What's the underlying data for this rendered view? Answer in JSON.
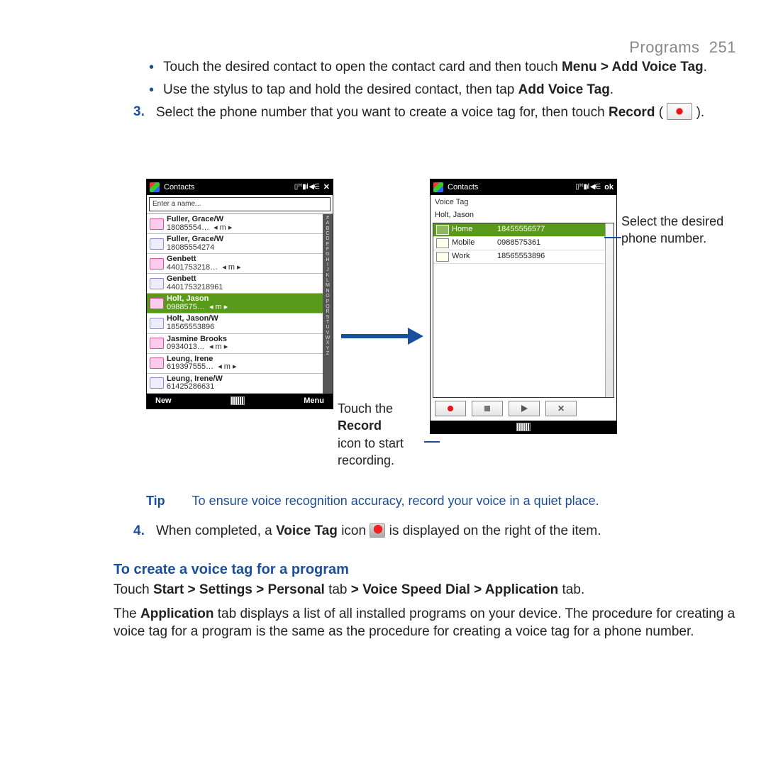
{
  "header": {
    "section": "Programs",
    "page": "251"
  },
  "bullets": [
    {
      "pre": "Touch the desired contact to open the contact card and then touch ",
      "bold": "Menu > Add Voice Tag",
      "post": "."
    },
    {
      "pre": "Use the stylus to tap and hold the desired contact, then tap ",
      "bold": "Add Voice Tag",
      "post": "."
    }
  ],
  "step3": {
    "num": "3.",
    "pre": "Select the phone number that you want to create a voice tag for, then touch ",
    "bold": "Record",
    "post": " ( "
  },
  "phone_left": {
    "title": "Contacts",
    "end_control": "✕",
    "search_placeholder": "Enter a name...",
    "rows": [
      {
        "name": "Fuller, Grace/W",
        "num": "18085554…",
        "marker": "◂ m ▸",
        "sim": false
      },
      {
        "name": "Fuller, Grace/W",
        "num": "18085554274",
        "marker": "",
        "sim": true
      },
      {
        "name": "Genbett",
        "num": "4401753218…",
        "marker": "◂ m ▸",
        "sim": false
      },
      {
        "name": "Genbett",
        "num": "4401753218961",
        "marker": "",
        "sim": true
      },
      {
        "name": "Holt, Jason",
        "num": "0988575…",
        "marker": "◂ m ▸",
        "sim": false,
        "selected": true
      },
      {
        "name": "Holt, Jason/W",
        "num": "18565553896",
        "marker": "",
        "sim": true
      },
      {
        "name": "Jasmine Brooks",
        "num": "0934013…",
        "marker": "◂ m ▸",
        "sim": false
      },
      {
        "name": "Leung, Irene",
        "num": "619397555…",
        "marker": "◂ m ▸",
        "sim": false
      },
      {
        "name": "Leung, Irene/W",
        "num": "61425286631",
        "marker": "",
        "sim": true
      }
    ],
    "az": "#\nA\nB\nC\nD\nE\nF\nG\nH\nI\nJ\nK\nL\nM\nN\nO\nP\nQ\nR\nS\nT\nU\nV\nW\nX\nY\nZ",
    "menu_left": "New",
    "menu_right": "Menu"
  },
  "phone_right": {
    "title": "Contacts",
    "end_control": "ok",
    "subtitle": "Voice Tag",
    "contact": "Holt, Jason",
    "entries": [
      {
        "label": "Home",
        "number": "18455556577",
        "selected": true
      },
      {
        "label": "Mobile",
        "number": "0988575361",
        "selected": false
      },
      {
        "label": "Work",
        "number": "18565553896",
        "selected": false
      }
    ]
  },
  "caption1": {
    "l1": "Touch the ",
    "bold": "Record",
    "l2": " icon to start recording."
  },
  "caption2": "Select the desired phone number.",
  "tip": {
    "label": "Tip",
    "text": "To ensure voice recognition accuracy, record your voice in a quiet place."
  },
  "step4": {
    "num": "4.",
    "pre": "When completed, a ",
    "bold": "Voice Tag",
    "mid": " icon ",
    "post": " is displayed on the right of the item."
  },
  "heading2": "To create a voice tag for a program",
  "para1": {
    "pre": "Touch ",
    "bold": "Start > Settings > Personal",
    "mid": " tab ",
    "bold2": "> Voice Speed Dial > Application",
    "post": " tab."
  },
  "para2": {
    "pre": "The ",
    "bold": "Application",
    "post": " tab displays a list of all installed programs on your device. The procedure for creating a voice tag for a program is the same as the procedure for creating a voice tag for a phone number."
  }
}
